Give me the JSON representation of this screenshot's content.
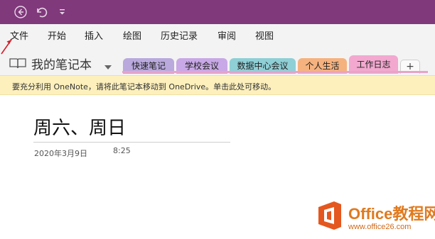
{
  "colors": {
    "titlebar": "#80397b",
    "menubar": "#f3f3f3",
    "infobar": "#fdf0bd",
    "accent": "#e07a1f",
    "annotation_arrow": "#d21e2a"
  },
  "titlebar": {
    "icons": [
      "back-icon",
      "undo-icon",
      "quick-access-dropdown-icon"
    ]
  },
  "menu": {
    "items": [
      "文件",
      "开始",
      "插入",
      "绘图",
      "历史记录",
      "审阅",
      "视图"
    ]
  },
  "notebook": {
    "icon": "book-open-icon",
    "title": "我的笔记本",
    "dropdown_icon": "caret-down-icon"
  },
  "sections": [
    {
      "label": "快速笔记",
      "color": "#b9a9dd"
    },
    {
      "label": "学校会议",
      "color": "#c8a8e6"
    },
    {
      "label": "数据中心会议",
      "color": "#8fcfd6"
    },
    {
      "label": "个人生活",
      "color": "#f5b27f"
    },
    {
      "label": "工作日志",
      "color": "#f2a8cf",
      "active": true
    }
  ],
  "add_section_label": "+",
  "infobar": {
    "message": "要充分利用 OneNote，请将此笔记本移动到 OneDrive。单击此处可移动。"
  },
  "page": {
    "title": "周六、周日",
    "date": "2020年3月9日",
    "time": "8:25"
  },
  "watermark": {
    "brand": "Office教程网",
    "url": "www.office26.com",
    "logo": "office-logo-icon"
  }
}
